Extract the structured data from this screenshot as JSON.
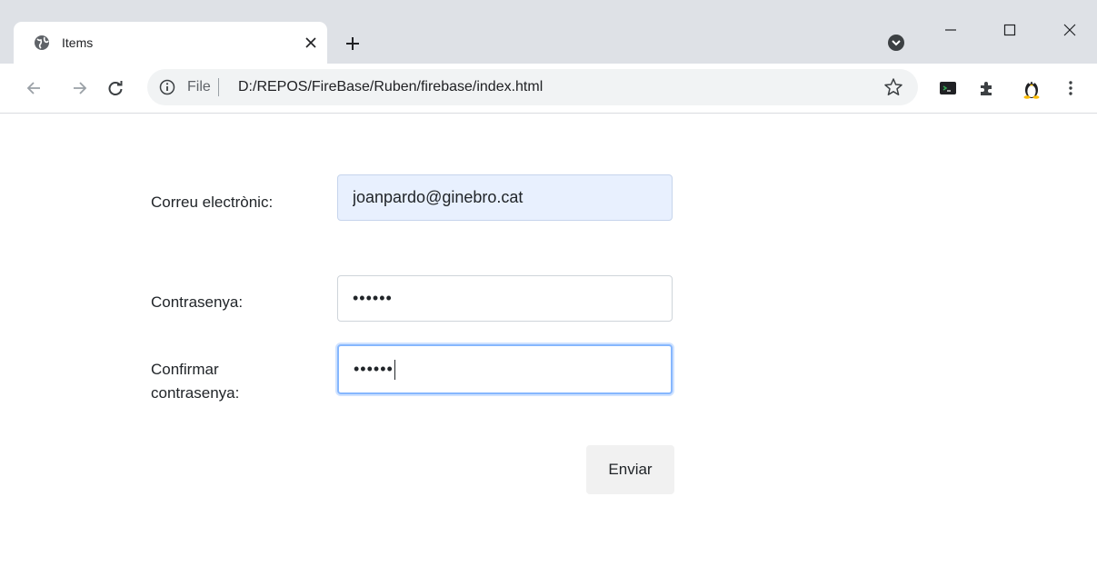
{
  "browser": {
    "tab_title": "Items",
    "address": {
      "scheme": "File",
      "url": "D:/REPOS/FireBase/Ruben/firebase/index.html"
    }
  },
  "form": {
    "email_label": "Correu electrònic:",
    "email_value": "joanpardo@ginebro.cat",
    "password_label": "Contrasenya:",
    "password_value": "••••••",
    "confirm_label": "Confirmar contrasenya:",
    "confirm_value": "••••••",
    "submit_label": "Enviar"
  },
  "colors": {
    "tabstrip": "#dee1e6",
    "autofill": "#e8f0fe",
    "focus_ring": "#86b7fe"
  }
}
